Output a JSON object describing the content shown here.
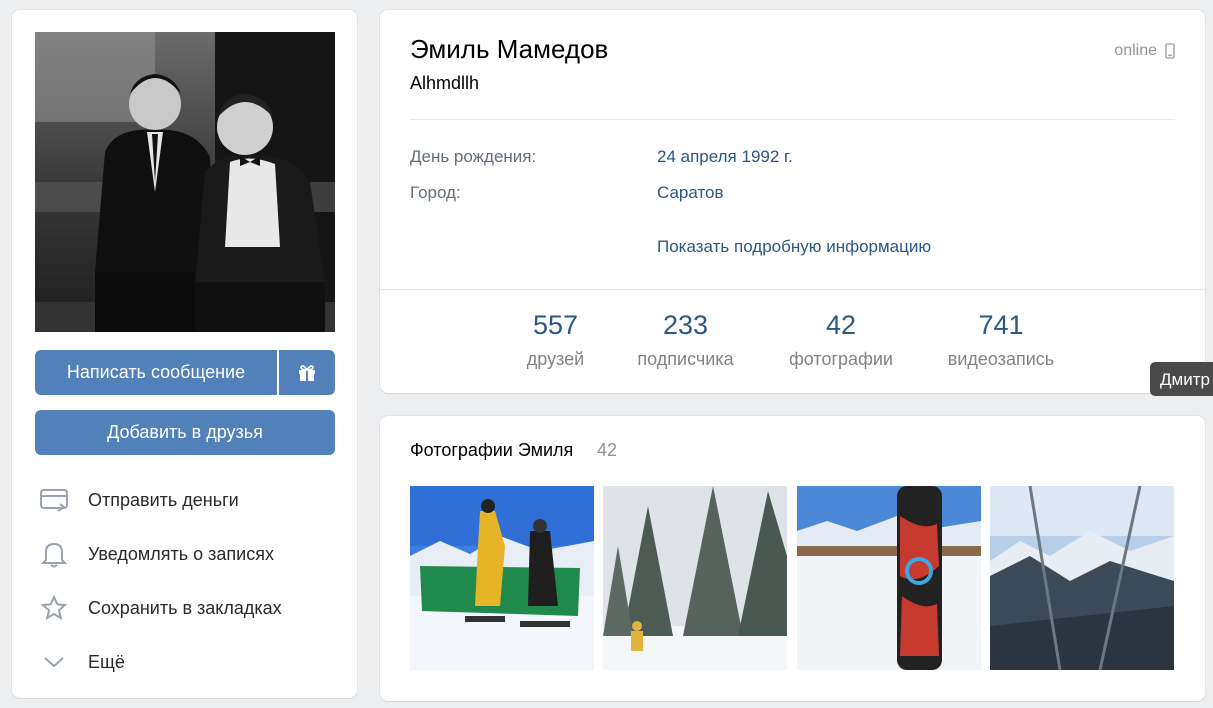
{
  "profile": {
    "name": "Эмиль Мамедов",
    "status": "Alhmdllh",
    "online": "online"
  },
  "left": {
    "message_button": "Написать сообщение",
    "add_friend_button": "Добавить в друзья",
    "actions": [
      {
        "label": "Отправить деньги",
        "icon": "card-send-icon"
      },
      {
        "label": "Уведомлять о записях",
        "icon": "bell-icon"
      },
      {
        "label": "Сохранить в закладках",
        "icon": "star-icon"
      },
      {
        "label": "Ещё",
        "icon": "chevron-down-icon"
      }
    ]
  },
  "info": {
    "birthday_label": "День рождения:",
    "birthday_value": "24 апреля 1992 г.",
    "city_label": "Город:",
    "city_value": "Саратов",
    "more_link": "Показать подробную информацию"
  },
  "counters": [
    {
      "num": "557",
      "label": "друзей"
    },
    {
      "num": "233",
      "label": "подписчика"
    },
    {
      "num": "42",
      "label": "фотографии"
    },
    {
      "num": "741",
      "label": "видеозапись"
    }
  ],
  "tooltip": "Дмитр",
  "photos": {
    "title": "Фотографии Эмиля",
    "count": "42"
  },
  "colors": {
    "accent": "#5181b8",
    "link": "#2a5885",
    "background": "#edeef0"
  }
}
